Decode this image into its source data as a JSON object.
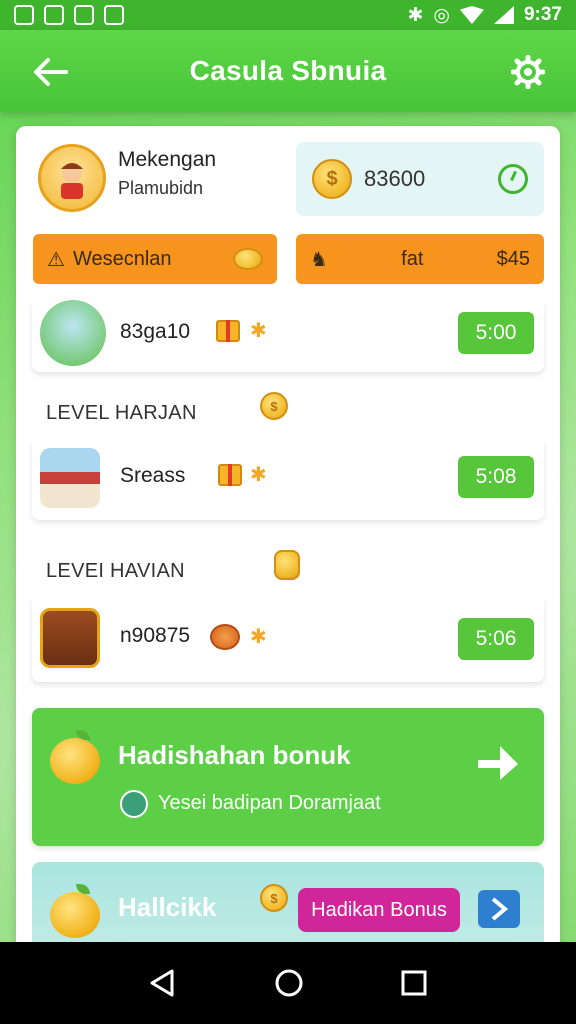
{
  "status_bar": {
    "time": "9:37"
  },
  "app_bar": {
    "title": "Casula Sbnuia"
  },
  "profile": {
    "name": "Mekengan",
    "subtitle": "Plamubidn"
  },
  "balance": {
    "amount": "83600"
  },
  "actions": {
    "left_label": "Wesecnlan",
    "right_middle": "fat",
    "right_value": "$45"
  },
  "rows": [
    {
      "label": "83ga10",
      "time": "5:00"
    },
    {
      "section": "LEVEL HARJAN",
      "label": "Sreass",
      "time": "5:08"
    },
    {
      "section": "LEVEI HAVIAN",
      "label": "n90875",
      "time": "5:06"
    }
  ],
  "promo1": {
    "title": "Hadishahan bonuk",
    "subtitle": "Yesei badipan Doramjaat"
  },
  "promo2": {
    "title": "Hallcikk",
    "button": "Hadikan Bonus"
  },
  "colors": {
    "green": "#58c63b",
    "orange": "#f7941d",
    "pink": "#d1259a"
  },
  "icons": [
    "back-arrow-icon",
    "gear-icon",
    "coin-icon",
    "clock-icon",
    "gift-icon",
    "chevron-right-icon"
  ]
}
